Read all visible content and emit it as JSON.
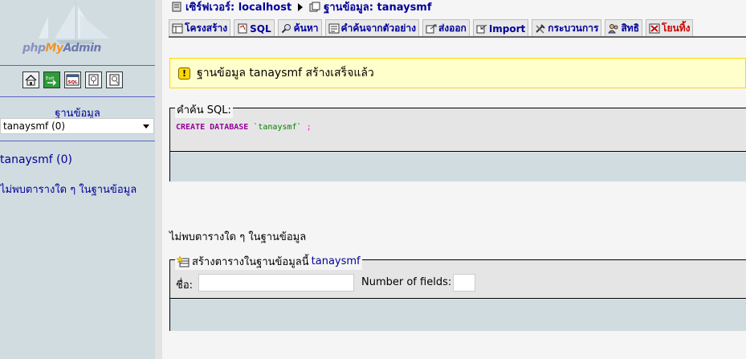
{
  "nav": {
    "logo": {
      "php": "php",
      "my": "My",
      "admin": "Admin"
    },
    "icons": [
      "home-icon",
      "exit-icon",
      "sql-query-icon",
      "docs-icon",
      "phpmyadmin-docs-icon"
    ],
    "icon_labels": {
      "exit": "Exit",
      "sql": "SQL"
    },
    "db_label": "ฐานข้อมูล",
    "db_select_value": "tanaysmf (0)",
    "db_link": "tanaysmf (0)",
    "no_tables": "ไม่พบตารางใด ๆ ในฐานข้อมูล"
  },
  "header": {
    "server_label": "เซิร์ฟเวอร์: localhost",
    "db_label": "ฐานข้อมูล: tanaysmf"
  },
  "tabs": [
    {
      "label": "โครงสร้าง",
      "icon": "structure-icon"
    },
    {
      "label": "SQL",
      "icon": "sql-icon"
    },
    {
      "label": "ค้นหา",
      "icon": "search-icon"
    },
    {
      "label": "คำค้นจากตัวอย่าง",
      "icon": "query-icon"
    },
    {
      "label": "ส่งออก",
      "icon": "export-icon"
    },
    {
      "label": "Import",
      "icon": "import-icon"
    },
    {
      "label": "กระบวนการ",
      "icon": "operations-icon"
    },
    {
      "label": "สิทธิ",
      "icon": "privileges-icon"
    },
    {
      "label": "โยนทิ้ง",
      "icon": "drop-icon"
    }
  ],
  "notice": {
    "text": "ฐานข้อมูล tanaysmf สร้างเสร็จแล้ว"
  },
  "sql_box": {
    "legend": "คำค้น SQL:",
    "keyword": "CREATE DATABASE",
    "identifier": "`tanaysmf`",
    "separator": ";"
  },
  "main_no_tables": "ไม่พบตารางใด ๆ ในฐานข้อมูล",
  "create_table": {
    "legend_prefix": "สร้างตารางในฐานข้อมูลนี้",
    "db_name": "tanaysmf",
    "name_label": "ชื่อ:",
    "name_value": "",
    "fields_label": "Number of fields:",
    "fields_value": ""
  },
  "colors": {
    "nav_bg": "#d0dce0",
    "link": "#000099",
    "notice_bg": "#ffffcc",
    "notice_border": "#ffd800",
    "sql_keyword": "#990099",
    "sql_identifier": "#008000",
    "drop_tab": "#cc0000"
  }
}
